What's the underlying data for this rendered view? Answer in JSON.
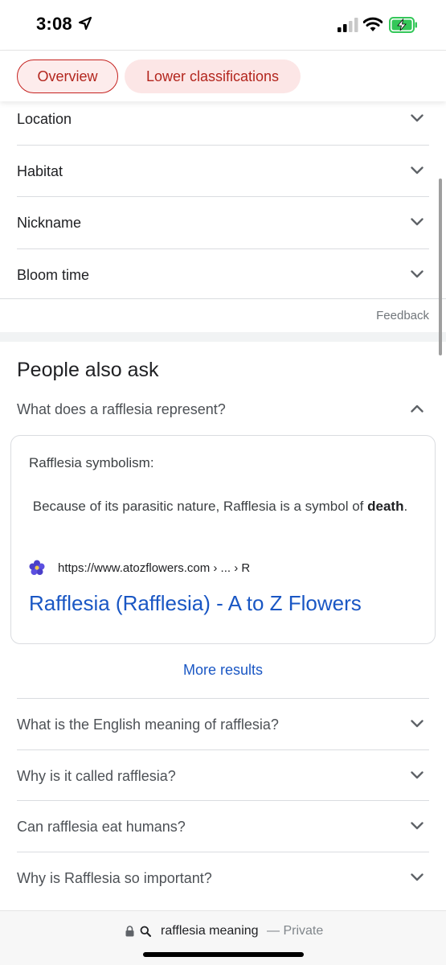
{
  "status_bar": {
    "time": "3:08",
    "icons": [
      "location-arrow-icon",
      "signal-icon",
      "wifi-icon",
      "battery-charging-icon"
    ]
  },
  "tabs": [
    {
      "label": "Overview",
      "selected": true
    },
    {
      "label": "Lower classifications",
      "selected": false
    }
  ],
  "accordion": [
    {
      "label": "Location"
    },
    {
      "label": "Habitat"
    },
    {
      "label": "Nickname"
    },
    {
      "label": "Bloom time"
    }
  ],
  "feedback_label": "Feedback",
  "people_also_ask": {
    "title": "People also ask",
    "open_question": "What does a rafflesia represent?",
    "answer": {
      "heading": "Rafflesia symbolism:",
      "text_before": "Because of its parasitic nature, Rafflesia is a symbol of",
      "bold_word": "death",
      "text_after": ".",
      "source_url": "https://www.atozflowers.com › ... › R",
      "source_title": "Rafflesia (Rafflesia) - A to Z Flowers"
    },
    "more_results": "More results",
    "questions": [
      "What is the English meaning of rafflesia?",
      "Why is it called rafflesia?",
      "Can rafflesia eat humans?",
      "Why is Rafflesia so important?"
    ]
  },
  "address_bar": {
    "query": "rafflesia meaning",
    "mode": "— Private"
  },
  "colors": {
    "chip_text": "#b3261e",
    "link_blue": "#1a57c4",
    "battery_green": "#34c759"
  }
}
